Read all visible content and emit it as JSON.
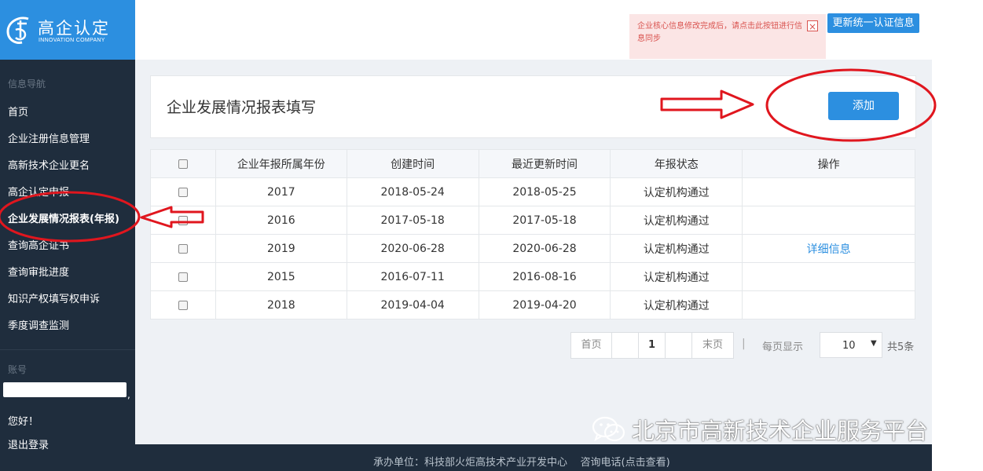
{
  "brand": {
    "title": "高企认定",
    "subtitle": "INNOVATION COMPANY",
    "color": "#2c8fe0"
  },
  "sidebar": {
    "section_nav": "信息导航",
    "items": [
      {
        "label": "首页"
      },
      {
        "label": "企业注册信息管理"
      },
      {
        "label": "高新技术企业更名"
      },
      {
        "label": "高企认定申报"
      },
      {
        "label": "企业发展情况报表(年报)",
        "active": true
      },
      {
        "label": "查询高企证书"
      },
      {
        "label": "查询审批进度"
      },
      {
        "label": "知识产权填写权申诉"
      },
      {
        "label": "季度调查监测"
      }
    ],
    "section_account": "账号",
    "account_comma": ",",
    "greeting": "您好！",
    "logout": "退出登录"
  },
  "top": {
    "notice_text": "企业核心信息修改完成后，请点击此按钮进行信息同步",
    "notice_close": "×",
    "update_button": "更新统一认证信息"
  },
  "panel": {
    "title": "企业发展情况报表填写",
    "add_button": "添加"
  },
  "table": {
    "headers": [
      "企业年报所属年份",
      "创建时间",
      "最近更新时间",
      "年报状态",
      "操作"
    ],
    "rows": [
      {
        "year": "2017",
        "created": "2018-05-24",
        "updated": "2018-05-25",
        "status": "认定机构通过",
        "action": ""
      },
      {
        "year": "2016",
        "created": "2017-05-18",
        "updated": "2017-05-18",
        "status": "认定机构通过",
        "action": ""
      },
      {
        "year": "2019",
        "created": "2020-06-28",
        "updated": "2020-06-28",
        "status": "认定机构通过",
        "action": "详细信息"
      },
      {
        "year": "2015",
        "created": "2016-07-11",
        "updated": "2016-08-16",
        "status": "认定机构通过",
        "action": ""
      },
      {
        "year": "2018",
        "created": "2019-04-04",
        "updated": "2019-04-20",
        "status": "认定机构通过",
        "action": ""
      }
    ]
  },
  "pagination": {
    "first": "首页",
    "current": "1",
    "last": "末页",
    "separator": "|",
    "per_page_label": "每页显示",
    "per_page_value": "10",
    "total": "共5条"
  },
  "footer": {
    "text": "承办单位：科技部火炬高技术产业开发中心    咨询电话(点击查看)"
  },
  "watermark": {
    "text": "北京市高新技术企业服务平台",
    "icon": "wechat-icon"
  },
  "annotation_color": "#e0161e"
}
